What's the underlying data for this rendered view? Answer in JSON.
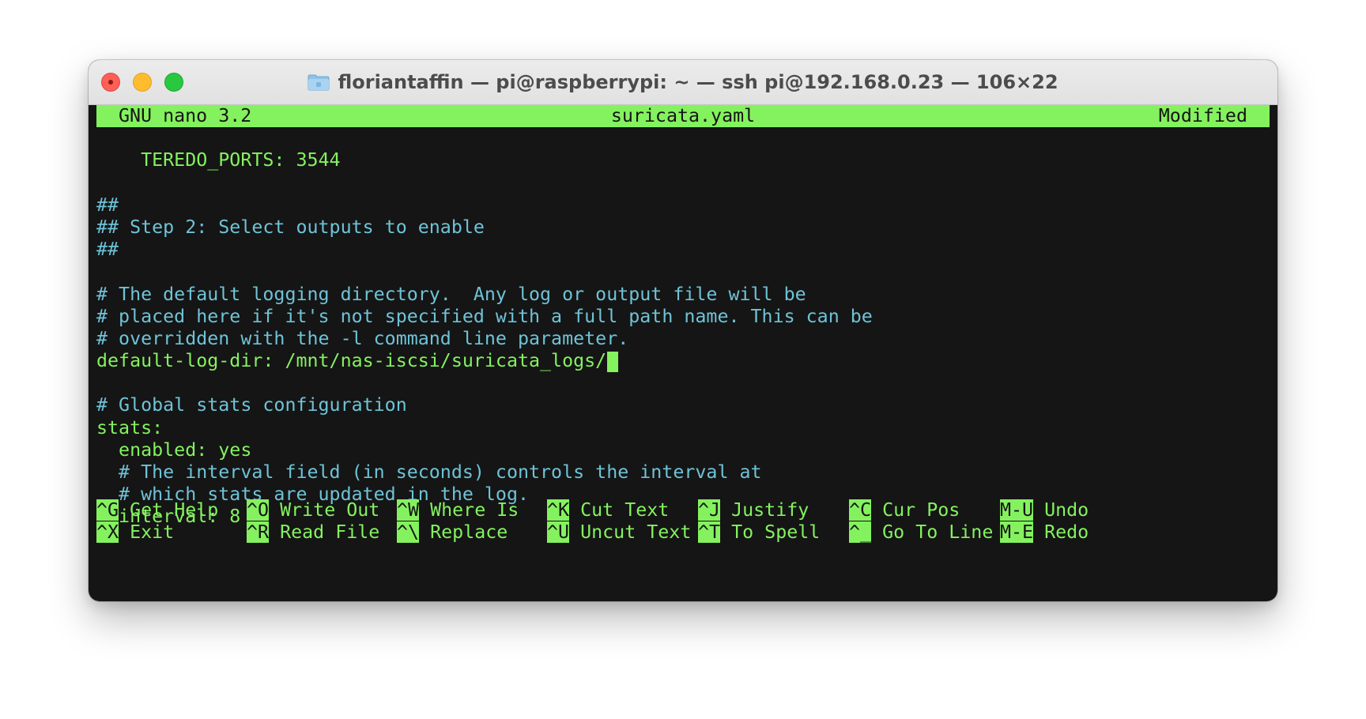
{
  "window": {
    "title": "floriantaffin — pi@raspberrypi: ~ — ssh pi@192.168.0.23 — 106×22",
    "title_icon": "folder-icon"
  },
  "nano": {
    "version": "GNU nano 3.2",
    "filename": "suricata.yaml",
    "status": "Modified"
  },
  "lines": [
    {
      "text": "",
      "color": "green"
    },
    {
      "text": "    TEREDO_PORTS: 3544",
      "color": "green"
    },
    {
      "text": "",
      "color": "green"
    },
    {
      "text": "##",
      "color": "cyan"
    },
    {
      "text": "## Step 2: Select outputs to enable",
      "color": "cyan"
    },
    {
      "text": "##",
      "color": "cyan"
    },
    {
      "text": "",
      "color": "green"
    },
    {
      "text": "# The default logging directory.  Any log or output file will be",
      "color": "cyan"
    },
    {
      "text": "# placed here if it's not specified with a full path name. This can be",
      "color": "cyan"
    },
    {
      "text": "# overridden with the -l command line parameter.",
      "color": "cyan"
    },
    {
      "text": "default-log-dir: /mnt/nas-iscsi/suricata_logs/",
      "color": "green"
    },
    {
      "text": "",
      "color": "green"
    },
    {
      "text": "# Global stats configuration",
      "color": "cyan"
    },
    {
      "text": "stats:",
      "color": "green"
    },
    {
      "text": "  enabled: yes",
      "color": "green"
    },
    {
      "text": "  # The interval field (in seconds) controls the interval at",
      "color": "cyan"
    },
    {
      "text": "  # which stats are updated in the log.",
      "color": "cyan"
    },
    {
      "text": "  interval: 8",
      "color": "green"
    },
    {
      "text": "",
      "color": "green"
    }
  ],
  "cursor_line": 10,
  "shortcuts": {
    "row1": [
      {
        "key": "^G",
        "label": "Get Help"
      },
      {
        "key": "^O",
        "label": "Write Out"
      },
      {
        "key": "^W",
        "label": "Where Is"
      },
      {
        "key": "^K",
        "label": "Cut Text"
      },
      {
        "key": "^J",
        "label": "Justify"
      },
      {
        "key": "^C",
        "label": "Cur Pos"
      },
      {
        "key": "M-U",
        "label": "Undo"
      }
    ],
    "row2": [
      {
        "key": "^X",
        "label": "Exit"
      },
      {
        "key": "^R",
        "label": "Read File"
      },
      {
        "key": "^\\",
        "label": "Replace"
      },
      {
        "key": "^U",
        "label": "Uncut Text"
      },
      {
        "key": "^T",
        "label": "To Spell"
      },
      {
        "key": "^_",
        "label": "Go To Line"
      },
      {
        "key": "M-E",
        "label": "Redo"
      }
    ]
  },
  "colors": {
    "green": "#84f25f",
    "cyan": "#6ec3d7",
    "background": "#151515"
  }
}
